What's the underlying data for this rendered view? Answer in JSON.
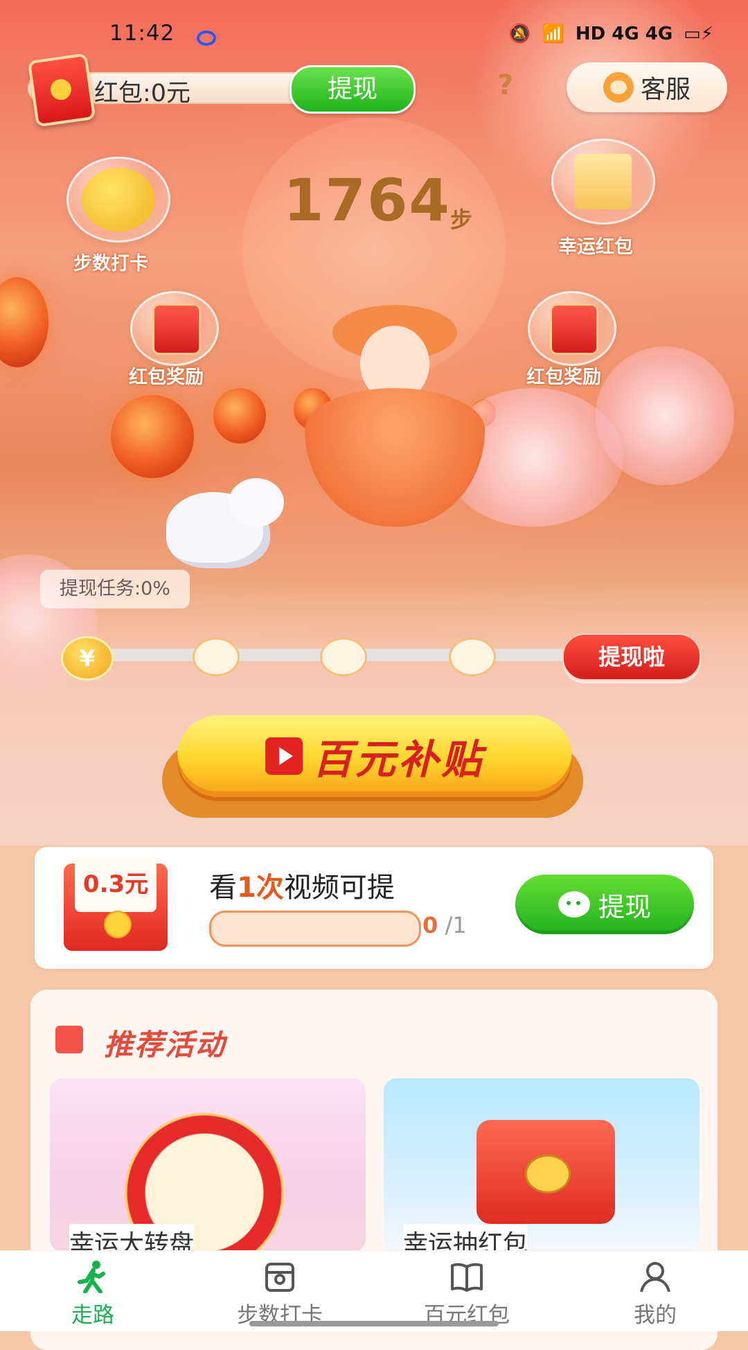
{
  "status_bar": {
    "time": "11:42",
    "icons": [
      "mute-icon",
      "wifi-icon",
      "hd-icon",
      "signal-4g-icon",
      "signal-4g-icon",
      "battery-icon"
    ],
    "indicators": "HD 4G 4G"
  },
  "top_bar": {
    "balance_label": "红包:0元",
    "withdraw_label": "提现",
    "help_label": "?",
    "service_label": "客服"
  },
  "steps": {
    "count": "1764",
    "unit": "步"
  },
  "bubbles": {
    "checkin": "步数打卡",
    "lucky_redpack": "幸运红包",
    "reward_left": "红包奖励",
    "reward_right": "红包奖励"
  },
  "progress": {
    "tooltip": "提现任务:0%",
    "start_symbol": "¥",
    "cashout_label": "提现啦",
    "value": 0
  },
  "subsidy_button": {
    "label": "百元补贴"
  },
  "task_card": {
    "amount": "0.3元",
    "title_prefix": "看",
    "title_count": "1次",
    "title_suffix": "视频可提",
    "progress_current": "0",
    "progress_total": " /1",
    "withdraw_label": "提现"
  },
  "activities": {
    "title": "推荐活动",
    "cards": [
      {
        "label": "幸运大转盘"
      },
      {
        "label": "幸运抽红包"
      }
    ]
  },
  "bottom_nav": {
    "items": [
      {
        "label": "走路",
        "icon": "walking-icon",
        "active": true
      },
      {
        "label": "步数打卡",
        "icon": "checkin-icon",
        "active": false
      },
      {
        "label": "百元红包",
        "icon": "book-icon",
        "active": false
      },
      {
        "label": "我的",
        "icon": "profile-icon",
        "active": false
      }
    ]
  },
  "colors": {
    "accent_green": "#1fb31d",
    "accent_red": "#d51c1c",
    "step_text": "#a86a24"
  }
}
